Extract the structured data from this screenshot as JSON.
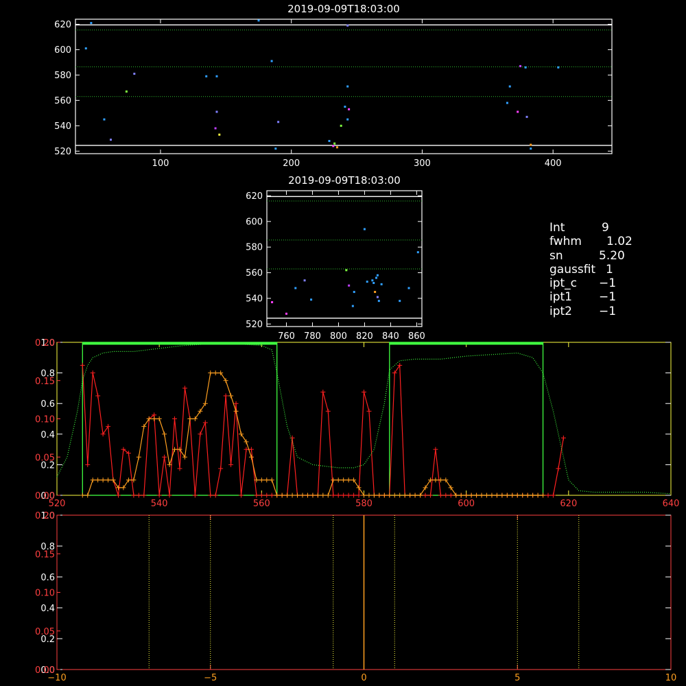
{
  "chart_data": [
    {
      "id": "scatter_top",
      "type": "scatter",
      "title": "2019-09-09T18:03:00",
      "xlim": [
        35,
        445
      ],
      "ylim": [
        518,
        624
      ],
      "xticks": [
        100,
        200,
        300,
        400
      ],
      "yticks": [
        520,
        540,
        560,
        580,
        600,
        620
      ],
      "hlines_white": [
        524.5,
        619.5
      ],
      "hlines_green": [
        563,
        586.5,
        615.5
      ],
      "points": [
        {
          "x": 47,
          "y": 621,
          "c": "#30a0ff"
        },
        {
          "x": 43,
          "y": 601,
          "c": "#30a0ff"
        },
        {
          "x": 57,
          "y": 545,
          "c": "#30a0ff"
        },
        {
          "x": 62,
          "y": 529,
          "c": "#8080ff"
        },
        {
          "x": 74,
          "y": 567,
          "c": "#80ff40"
        },
        {
          "x": 80,
          "y": 581,
          "c": "#8080ff"
        },
        {
          "x": 135,
          "y": 579,
          "c": "#30a0ff"
        },
        {
          "x": 143,
          "y": 579,
          "c": "#30a0ff"
        },
        {
          "x": 143,
          "y": 551,
          "c": "#8080ff"
        },
        {
          "x": 142,
          "y": 538,
          "c": "#c040ff"
        },
        {
          "x": 145,
          "y": 533,
          "c": "#ffff40"
        },
        {
          "x": 175,
          "y": 623,
          "c": "#30a0ff"
        },
        {
          "x": 185,
          "y": 591,
          "c": "#30a0ff"
        },
        {
          "x": 190,
          "y": 543,
          "c": "#8080ff"
        },
        {
          "x": 188,
          "y": 522,
          "c": "#30a0ff"
        },
        {
          "x": 229,
          "y": 528,
          "c": "#30a0ff"
        },
        {
          "x": 232,
          "y": 524,
          "c": "#ff40ff"
        },
        {
          "x": 235,
          "y": 523,
          "c": "#ffa020"
        },
        {
          "x": 233,
          "y": 526,
          "c": "#80ff40"
        },
        {
          "x": 238,
          "y": 540,
          "c": "#80ff40"
        },
        {
          "x": 241,
          "y": 555,
          "c": "#30a0ff"
        },
        {
          "x": 243,
          "y": 545,
          "c": "#30a0ff"
        },
        {
          "x": 244,
          "y": 553,
          "c": "#ff40ff"
        },
        {
          "x": 243,
          "y": 571,
          "c": "#30a0ff"
        },
        {
          "x": 243,
          "y": 619,
          "c": "#8080ff"
        },
        {
          "x": 365,
          "y": 558,
          "c": "#30a0ff"
        },
        {
          "x": 367,
          "y": 571,
          "c": "#30a0ff"
        },
        {
          "x": 373,
          "y": 551,
          "c": "#ff40ff"
        },
        {
          "x": 375,
          "y": 587,
          "c": "#c040ff"
        },
        {
          "x": 379,
          "y": 586,
          "c": "#30a0ff"
        },
        {
          "x": 380,
          "y": 547,
          "c": "#8080ff"
        },
        {
          "x": 383,
          "y": 525,
          "c": "#ffa020"
        },
        {
          "x": 383,
          "y": 522,
          "c": "#30a0ff"
        },
        {
          "x": 404,
          "y": 586,
          "c": "#30a0ff"
        }
      ]
    },
    {
      "id": "scatter_mid",
      "type": "scatter",
      "title": "2019-09-09T18:03:00",
      "xlim": [
        745,
        864
      ],
      "ylim": [
        518,
        624
      ],
      "xticks": [
        760,
        780,
        800,
        820,
        840,
        860
      ],
      "yticks": [
        520,
        540,
        560,
        580,
        600,
        620
      ],
      "hlines_white": [
        524.5,
        619.5
      ],
      "hlines_green": [
        563,
        585.5,
        616
      ],
      "points": [
        {
          "x": 749,
          "y": 537,
          "c": "#ff40ff"
        },
        {
          "x": 760,
          "y": 528,
          "c": "#ff40ff"
        },
        {
          "x": 767,
          "y": 548,
          "c": "#30a0ff"
        },
        {
          "x": 774,
          "y": 554,
          "c": "#8080ff"
        },
        {
          "x": 779,
          "y": 539,
          "c": "#30a0ff"
        },
        {
          "x": 806,
          "y": 562,
          "c": "#80ff40"
        },
        {
          "x": 808,
          "y": 550,
          "c": "#c040ff"
        },
        {
          "x": 812,
          "y": 545,
          "c": "#30a0ff"
        },
        {
          "x": 811,
          "y": 534,
          "c": "#30a0ff"
        },
        {
          "x": 820,
          "y": 594,
          "c": "#30a0ff"
        },
        {
          "x": 822,
          "y": 553,
          "c": "#30a0ff"
        },
        {
          "x": 826,
          "y": 554,
          "c": "#30a0ff"
        },
        {
          "x": 827,
          "y": 552,
          "c": "#30a0ff"
        },
        {
          "x": 829,
          "y": 556,
          "c": "#30a0ff"
        },
        {
          "x": 830,
          "y": 558,
          "c": "#30a0ff"
        },
        {
          "x": 833,
          "y": 551,
          "c": "#30a0ff"
        },
        {
          "x": 828,
          "y": 545,
          "c": "#ffa020"
        },
        {
          "x": 830,
          "y": 541,
          "c": "#8080ff"
        },
        {
          "x": 831,
          "y": 538,
          "c": "#30a0ff"
        },
        {
          "x": 847,
          "y": 538,
          "c": "#30a0ff"
        },
        {
          "x": 854,
          "y": 548,
          "c": "#30a0ff"
        },
        {
          "x": 861,
          "y": 576,
          "c": "#30a0ff"
        }
      ]
    },
    {
      "id": "profile",
      "type": "line",
      "xlim": [
        520,
        640
      ],
      "xticks": [
        520,
        540,
        560,
        580,
        600,
        620,
        640
      ],
      "y_left_white": {
        "lim": [
          0,
          1.0
        ],
        "ticks": [
          0.0,
          0.2,
          0.4,
          0.6,
          0.8,
          1.0
        ],
        "tick_labels": [
          "0.0",
          "0.2",
          "0.4",
          "0.6",
          "0.8",
          "1.0"
        ]
      },
      "y_left_red": {
        "lim": [
          0,
          0.2
        ],
        "ticks": [
          0.0,
          0.05,
          0.1,
          0.15,
          0.2
        ],
        "tick_labels": [
          "0.00",
          "0.05",
          "0.10",
          "0.15",
          "0.20"
        ]
      },
      "series": [
        {
          "color": "#ff2020",
          "axis": "red",
          "marker": "+",
          "x": [
            525,
            526,
            527,
            528,
            529,
            530,
            531,
            532,
            533,
            534,
            535,
            536,
            537,
            538,
            539,
            540,
            541,
            542,
            543,
            544,
            545,
            546,
            547,
            548,
            549,
            550,
            551,
            552,
            553,
            554,
            555,
            556,
            557,
            558,
            559,
            560,
            561,
            562,
            563,
            564,
            565,
            566,
            567,
            568,
            569,
            570,
            571,
            572,
            573,
            574,
            575,
            576,
            577,
            578,
            579,
            580,
            581,
            582,
            583,
            584,
            585,
            586,
            587,
            588,
            589,
            590,
            591,
            592,
            593,
            594,
            595,
            596,
            597,
            598,
            599,
            600,
            601,
            602,
            603,
            604,
            605,
            606,
            607,
            608,
            609,
            610,
            611,
            612,
            613,
            614,
            615,
            616,
            617,
            618,
            619
          ],
          "y": [
            0.17,
            0.04,
            0.16,
            0.13,
            0.08,
            0.09,
            0.02,
            0.0,
            0.06,
            0.055,
            0.0,
            0.0,
            0.0,
            0.1,
            0.105,
            0.0,
            0.05,
            0.0,
            0.1,
            0.035,
            0.14,
            0.1,
            0.0,
            0.08,
            0.095,
            0.0,
            0.0,
            0.035,
            0.13,
            0.04,
            0.12,
            0.0,
            0.06,
            0.06,
            0.0,
            0.0,
            0.0,
            0.0,
            0.0,
            0.0,
            0.0,
            0.075,
            0.0,
            0.0,
            0.0,
            0.0,
            0.0,
            0.135,
            0.11,
            0.0,
            0.0,
            0.0,
            0.0,
            0.0,
            0.0,
            0.135,
            0.11,
            0.0,
            0.0,
            0.0,
            0.0,
            0.16,
            0.17,
            0.0,
            0.0,
            0.0,
            0.0,
            0.0,
            0.0,
            0.06,
            0.0,
            0.0,
            0.0,
            0.0,
            0.0,
            0.0,
            0.0,
            0.0,
            0.0,
            0.0,
            0.0,
            0.0,
            0.0,
            0.0,
            0.0,
            0.0,
            0.0,
            0.0,
            0.0,
            0.0,
            0.0,
            0.0,
            0.0,
            0.035,
            0.075
          ]
        },
        {
          "color": "#ffa020",
          "axis": "white",
          "marker": "+",
          "x": [
            525,
            526,
            527,
            528,
            529,
            530,
            531,
            532,
            533,
            534,
            535,
            536,
            537,
            538,
            539,
            540,
            541,
            542,
            543,
            544,
            545,
            546,
            547,
            548,
            549,
            550,
            551,
            552,
            553,
            554,
            555,
            556,
            557,
            558,
            559,
            560,
            561,
            562,
            563,
            564,
            565,
            566,
            567,
            568,
            569,
            570,
            571,
            572,
            573,
            574,
            575,
            576,
            577,
            578,
            579,
            580,
            581,
            582,
            583,
            584,
            585,
            586,
            587,
            588,
            589,
            590,
            591,
            592,
            593,
            594,
            595,
            596,
            597,
            598,
            599,
            600,
            601,
            602,
            603,
            604,
            605,
            606,
            607,
            608,
            609,
            610,
            611,
            612,
            613,
            614,
            615
          ],
          "y": [
            0.0,
            0.0,
            0.1,
            0.1,
            0.1,
            0.1,
            0.1,
            0.05,
            0.05,
            0.1,
            0.1,
            0.25,
            0.45,
            0.5,
            0.5,
            0.5,
            0.4,
            0.2,
            0.3,
            0.3,
            0.25,
            0.5,
            0.5,
            0.55,
            0.6,
            0.8,
            0.8,
            0.8,
            0.75,
            0.65,
            0.55,
            0.4,
            0.35,
            0.25,
            0.1,
            0.1,
            0.1,
            0.1,
            0.0,
            0.0,
            0.0,
            0.0,
            0.0,
            0.0,
            0.0,
            0.0,
            0.0,
            0.0,
            0.0,
            0.1,
            0.1,
            0.1,
            0.1,
            0.1,
            0.05,
            0.0,
            0.0,
            0.0,
            0.0,
            0.0,
            0.0,
            0.0,
            0.0,
            0.0,
            0.0,
            0.0,
            0.0,
            0.05,
            0.1,
            0.1,
            0.1,
            0.1,
            0.05,
            0.0,
            0.0,
            0.0,
            0.0,
            0.0,
            0.0,
            0.0,
            0.0,
            0.0,
            0.0,
            0.0,
            0.0,
            0.0,
            0.0,
            0.0,
            0.0,
            0.0,
            0.0
          ]
        },
        {
          "color": "#40ff40",
          "axis": "white",
          "style": "dotted",
          "x": [
            520,
            522,
            524,
            525,
            526,
            527,
            529,
            531,
            535,
            540,
            545,
            550,
            555,
            560,
            562,
            563,
            565,
            567,
            570,
            575,
            578,
            580,
            582,
            584,
            585,
            587,
            590,
            595,
            600,
            605,
            610,
            613,
            615,
            617,
            619,
            620,
            622,
            625,
            630,
            635,
            640
          ],
          "y": [
            0.12,
            0.25,
            0.55,
            0.75,
            0.85,
            0.9,
            0.93,
            0.94,
            0.94,
            0.96,
            0.98,
            0.99,
            0.99,
            0.98,
            0.95,
            0.8,
            0.45,
            0.25,
            0.2,
            0.18,
            0.18,
            0.2,
            0.3,
            0.6,
            0.82,
            0.88,
            0.89,
            0.89,
            0.91,
            0.92,
            0.93,
            0.9,
            0.8,
            0.55,
            0.25,
            0.1,
            0.03,
            0.02,
            0.02,
            0.02,
            0.01
          ]
        }
      ],
      "windows_green": [
        [
          525,
          563
        ],
        [
          585,
          615
        ]
      ]
    },
    {
      "id": "bottom",
      "type": "line",
      "xlim": [
        -10,
        10
      ],
      "xticks": [
        -10,
        -5,
        0,
        5,
        10
      ],
      "y_left_white": {
        "lim": [
          0,
          1.0
        ],
        "ticks": [
          0.0,
          0.2,
          0.4,
          0.6,
          0.8,
          1.0
        ],
        "tick_labels": [
          "0.0",
          "0.2",
          "0.4",
          "0.6",
          "0.8",
          "1.0"
        ]
      },
      "y_left_red": {
        "lim": [
          0,
          0.2
        ],
        "ticks": [
          0.0,
          0.05,
          0.1,
          0.15,
          0.2
        ],
        "tick_labels": [
          "0.00",
          "0.05",
          "0.10",
          "0.15",
          "0.20"
        ]
      },
      "vlines_yellow": [
        -7,
        -5,
        -1,
        1,
        5,
        7
      ],
      "vline_orange": [
        0
      ]
    }
  ],
  "info": [
    {
      "key": "Int",
      "value": "9"
    },
    {
      "key": "fwhm",
      "value": "1.02"
    },
    {
      "key": "sn",
      "value": "5.20"
    },
    {
      "key": "gaussfit",
      "value": "1"
    },
    {
      "key": "ipt_c",
      "value": "−1"
    },
    {
      "key": "ipt1",
      "value": "−1"
    },
    {
      "key": "ipt2",
      "value": "−1"
    }
  ]
}
